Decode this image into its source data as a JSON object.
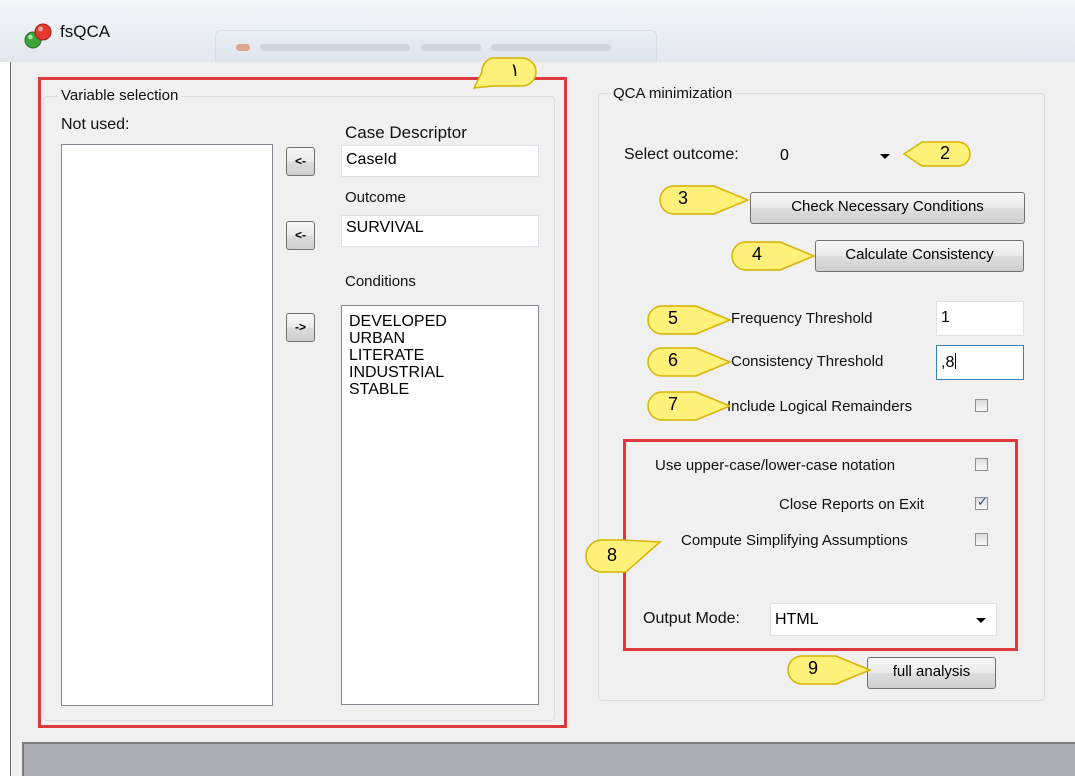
{
  "window": {
    "title": "fsQCA",
    "icon": "traffic-light-icon"
  },
  "variable_selection": {
    "group_title": "Variable selection",
    "not_used_label": "Not used:",
    "not_used_items": [],
    "case_descriptor_label": "Case Descriptor",
    "case_descriptor_value": "CaseId",
    "outcome_label": "Outcome",
    "outcome_value": "SURVIVAL",
    "conditions_label": "Conditions",
    "conditions_items": [
      "DEVELOPED",
      "URBAN",
      "LITERATE",
      "INDUSTRIAL",
      "STABLE"
    ],
    "move_case_descriptor_button": "<-",
    "move_outcome_button": "<-",
    "move_condition_button": "->"
  },
  "qca_minimization": {
    "group_title": "QCA minimization",
    "select_outcome_label": "Select outcome:",
    "select_outcome_value": "0",
    "check_necessary_button": "Check Necessary Conditions",
    "calculate_consistency_button": "Calculate Consistency",
    "frequency_threshold_label": "Frequency Threshold",
    "frequency_threshold_value": "1",
    "consistency_threshold_label": "Consistency Threshold",
    "consistency_threshold_value": ",8",
    "include_remainders_label": "Include Logical Remainders",
    "include_remainders_checked": false,
    "uppercase_notation_label": "Use upper-case/lower-case notation",
    "uppercase_notation_checked": false,
    "close_reports_label": "Close Reports on Exit",
    "close_reports_checked": true,
    "simplifying_assumptions_label": "Compute Simplifying Assumptions",
    "simplifying_assumptions_checked": false,
    "output_mode_label": "Output Mode:",
    "output_mode_value": "HTML",
    "full_analysis_button": "full analysis"
  },
  "callouts": [
    "١",
    "2",
    "3",
    "4",
    "5",
    "6",
    "7",
    "8",
    "9"
  ],
  "colors": {
    "highlight_red": "#e0393d",
    "callout_yellow": "#fff27a",
    "window_background": "#f0f0f0",
    "status_panel": "#abadb3"
  }
}
